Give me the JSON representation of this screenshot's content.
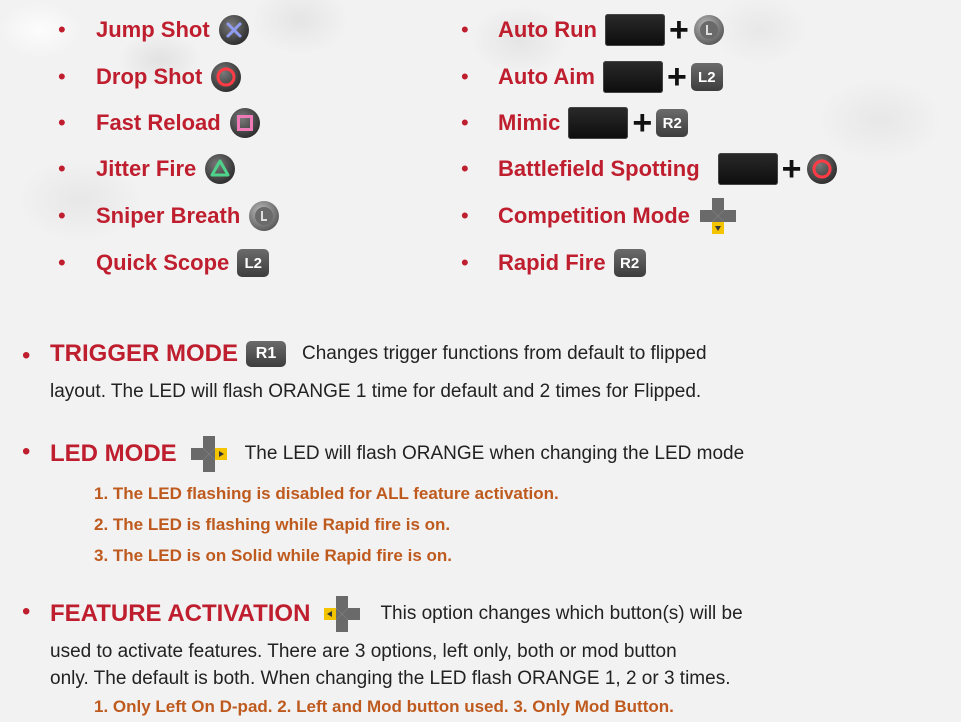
{
  "left_features": [
    {
      "label": "Jump Shot",
      "icon": "cross-button-icon"
    },
    {
      "label": "Drop Shot",
      "icon": "circle-button-icon"
    },
    {
      "label": "Fast Reload",
      "icon": "square-button-icon"
    },
    {
      "label": "Jitter Fire",
      "icon": "triangle-button-icon"
    },
    {
      "label": "Sniper Breath",
      "icon": "left-stick-icon"
    },
    {
      "label": "Quick Scope",
      "icon": "l2-button-icon",
      "tag": "L2"
    }
  ],
  "right_features": [
    {
      "label": "Auto Run",
      "icon": "left-stick-icon"
    },
    {
      "label": "Auto Aim",
      "icon": "l2-button-icon",
      "tag": "L2"
    },
    {
      "label": "Mimic",
      "icon": "r2-button-icon",
      "tag": "R2"
    },
    {
      "label": "Battlefield Spotting",
      "icon": "circle-button-icon"
    },
    {
      "label": "Competition Mode",
      "icon": "dpad-down-icon"
    },
    {
      "label": "Rapid Fire",
      "icon": "r2-button-icon",
      "tag": "R2"
    }
  ],
  "plus_sign": "+",
  "trigger_mode": {
    "title": "TRIGGER MODE",
    "tag": "R1",
    "line1": "Changes trigger functions from default to flipped",
    "line2": "layout. The LED will flash ORANGE 1 time for default and 2 times for Flipped."
  },
  "led_mode": {
    "title": "LED MODE",
    "desc": "The LED will flash ORANGE when changing the LED mode",
    "items": [
      "1.  The LED flashing is disabled for ALL feature activation.",
      "2.  The LED is flashing while Rapid fire is on.",
      "3.  The LED is on Solid while Rapid fire is on."
    ]
  },
  "feature_activation": {
    "title": "FEATURE ACTIVATION",
    "line1": "This option changes which button(s) will be",
    "line2": "used to activate features. There are 3 options, left only, both or mod button",
    "line3": "only. The default is both. When changing  the LED flash ORANGE 1, 2 or 3 times.",
    "item": "1.  Only Left On D-pad. 2. Left and Mod button used. 3. Only Mod Button."
  },
  "colors": {
    "heading_red": "#bf1e2e",
    "orange": "#bf5a1e",
    "cross_blue": "#7b86d8",
    "circle_red": "#e0303a",
    "square_pink": "#e06aa8",
    "triangle_green": "#3fbf7a"
  }
}
